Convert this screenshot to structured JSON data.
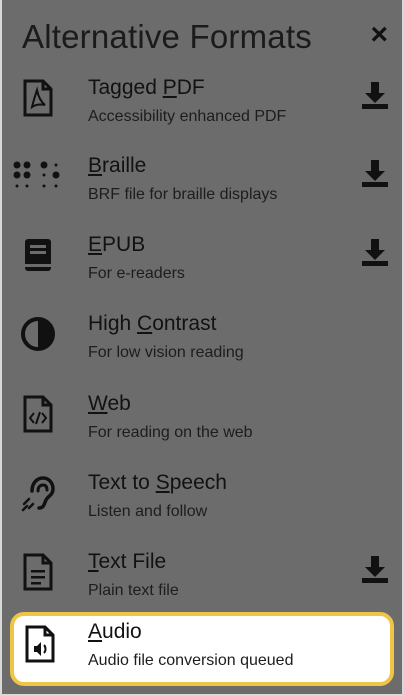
{
  "header": {
    "title": "Alternative Formats",
    "close_label": "×"
  },
  "items": [
    {
      "prefix": "Tagged ",
      "accel": "P",
      "suffix": "DF",
      "desc": "Accessibility enhanced PDF",
      "icon": "pdf-file-icon",
      "download": true
    },
    {
      "prefix": "",
      "accel": "B",
      "suffix": "raille",
      "desc": "BRF file for braille displays",
      "icon": "braille-icon",
      "download": true
    },
    {
      "prefix": "",
      "accel": "E",
      "suffix": "PUB",
      "desc": "For e-readers",
      "icon": "book-icon",
      "download": true
    },
    {
      "prefix": "High ",
      "accel": "C",
      "suffix": "ontrast",
      "desc": "For low vision reading",
      "icon": "contrast-icon",
      "download": false
    },
    {
      "prefix": "",
      "accel": "W",
      "suffix": "eb",
      "desc": "For reading on the web",
      "icon": "code-file-icon",
      "download": false
    },
    {
      "prefix": "Text to ",
      "accel": "S",
      "suffix": "peech",
      "desc": "Listen and follow",
      "icon": "hearing-icon",
      "download": false
    },
    {
      "prefix": "",
      "accel": "T",
      "suffix": "ext File",
      "desc": "Plain text file",
      "icon": "text-file-icon",
      "download": true
    },
    {
      "prefix": "",
      "accel": "A",
      "suffix": "udio",
      "desc": "Audio file conversion queued",
      "icon": "audio-file-icon",
      "download": false
    }
  ],
  "colors": {
    "background": "#6c6c6c",
    "highlight_border": "#f0c445",
    "highlight_bg": "#ffffff"
  }
}
